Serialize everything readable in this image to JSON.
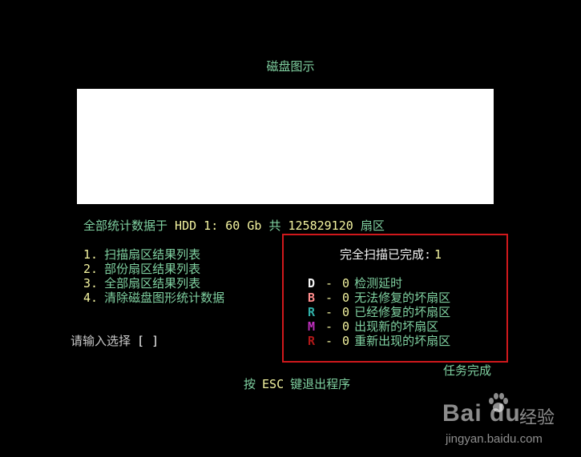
{
  "screen": {
    "title": "磁盘图示",
    "stats": {
      "prefix": "全部统计数据于",
      "drive": "HDD 1:",
      "size": "60 Gb",
      "mid": "共",
      "sectors": "125829120",
      "suffix": "扇区"
    },
    "menu": [
      {
        "num": "1.",
        "label": "扫描扇区结果列表"
      },
      {
        "num": "2.",
        "label": "部份扇区结果列表"
      },
      {
        "num": "3.",
        "label": "全部扇区结果列表"
      },
      {
        "num": "4.",
        "label": "清除磁盘图形统计数据"
      }
    ],
    "prompt": {
      "label": "请输入选择",
      "brackets": "[ ]"
    },
    "results": {
      "scan_complete_label": "完全扫描已完成:",
      "scan_complete_count": "1",
      "legend": [
        {
          "letter": "D",
          "color": "#f4f4f4",
          "sep": "-",
          "count": "0",
          "text": "检测延时"
        },
        {
          "letter": "B",
          "color": "#ff8c8c",
          "sep": "-",
          "count": "0",
          "text": "无法修复的坏扇区"
        },
        {
          "letter": "R",
          "color": "#30b0a8",
          "sep": "-",
          "count": "0",
          "text": "已经修复的坏扇区"
        },
        {
          "letter": "M",
          "color": "#c030c0",
          "sep": "-",
          "count": "0",
          "text": "出现新的坏扇区"
        },
        {
          "letter": "R",
          "color": "#b01818",
          "sep": "-",
          "count": "0",
          "text": "重新出现的坏扇区"
        }
      ]
    },
    "task_done": "任务完成",
    "exit_hint": {
      "prefix": "按",
      "key": "ESC",
      "suffix": "键退出程序"
    },
    "colors": {
      "background": "#000000",
      "accent_green": "#7fd0a0",
      "accent_yellow": "#f4f4a0",
      "box_border": "#d0181c"
    }
  },
  "watermark": {
    "logo": "Bai  du",
    "jingyan": "经验",
    "url": "jingyan.baidu.com",
    "icon": "paw-icon"
  }
}
